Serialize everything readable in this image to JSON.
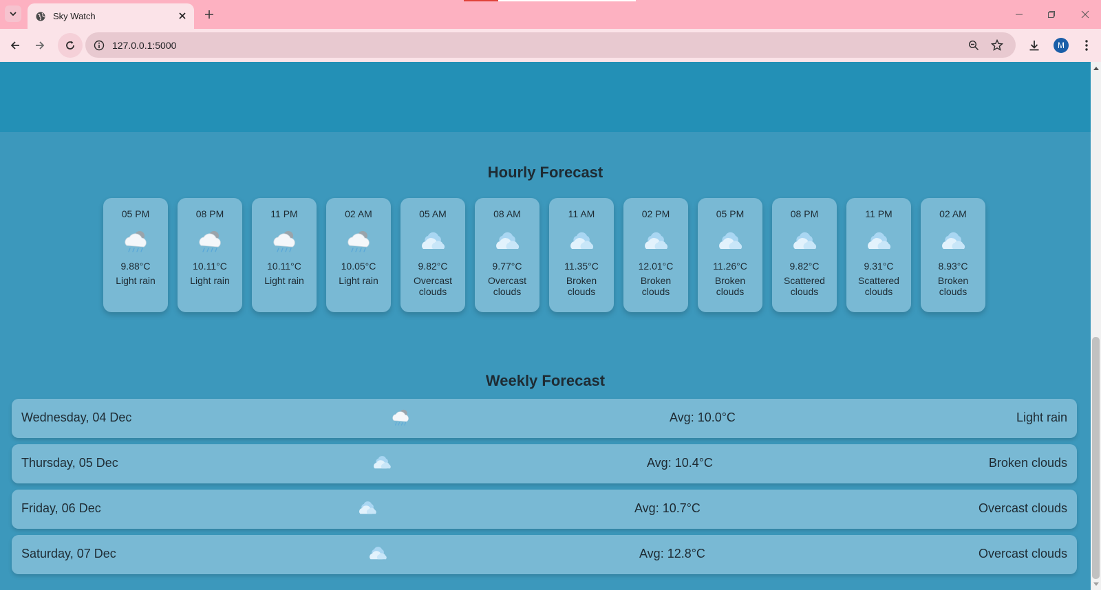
{
  "browser": {
    "tab_title": "Sky Watch",
    "url": "127.0.0.1:5000",
    "profile_initial": "M",
    "icons": {
      "tab_search": "chevron-down-icon",
      "tab_favicon": "globe-icon",
      "tab_close": "close-icon",
      "new_tab": "plus-icon",
      "minimize": "minimize-icon",
      "restore": "restore-icon",
      "window_close": "close-icon",
      "back": "arrow-left-icon",
      "forward": "arrow-right-icon",
      "reload": "reload-icon",
      "site_info": "info-icon",
      "zoom": "zoom-out-icon",
      "bookmark": "star-icon",
      "downloads": "download-icon",
      "menu": "kebab-menu-icon"
    }
  },
  "hourly": {
    "title": "Hourly Forecast",
    "items": [
      {
        "time": "05 PM",
        "temp": "9.88°C",
        "desc": "Light rain",
        "icon": "rain-cloud-icon"
      },
      {
        "time": "08 PM",
        "temp": "10.11°C",
        "desc": "Light rain",
        "icon": "rain-cloud-icon"
      },
      {
        "time": "11 PM",
        "temp": "10.11°C",
        "desc": "Light rain",
        "icon": "rain-cloud-icon"
      },
      {
        "time": "02 AM",
        "temp": "10.05°C",
        "desc": "Light rain",
        "icon": "rain-cloud-icon"
      },
      {
        "time": "05 AM",
        "temp": "9.82°C",
        "desc": "Overcast clouds",
        "icon": "clouds-icon"
      },
      {
        "time": "08 AM",
        "temp": "9.77°C",
        "desc": "Overcast clouds",
        "icon": "clouds-icon"
      },
      {
        "time": "11 AM",
        "temp": "11.35°C",
        "desc": "Broken clouds",
        "icon": "clouds-icon"
      },
      {
        "time": "02 PM",
        "temp": "12.01°C",
        "desc": "Broken clouds",
        "icon": "clouds-icon"
      },
      {
        "time": "05 PM",
        "temp": "11.26°C",
        "desc": "Broken clouds",
        "icon": "clouds-icon"
      },
      {
        "time": "08 PM",
        "temp": "9.82°C",
        "desc": "Scattered clouds",
        "icon": "clouds-icon"
      },
      {
        "time": "11 PM",
        "temp": "9.31°C",
        "desc": "Scattered clouds",
        "icon": "clouds-icon"
      },
      {
        "time": "02 AM",
        "temp": "8.93°C",
        "desc": "Broken clouds",
        "icon": "clouds-icon"
      }
    ]
  },
  "weekly": {
    "title": "Weekly Forecast",
    "items": [
      {
        "day": "Wednesday, 04 Dec",
        "avg": "Avg: 10.0°C",
        "desc": "Light rain",
        "icon": "rain-cloud-icon"
      },
      {
        "day": "Thursday, 05 Dec",
        "avg": "Avg: 10.4°C",
        "desc": "Broken clouds",
        "icon": "clouds-icon"
      },
      {
        "day": "Friday, 06 Dec",
        "avg": "Avg: 10.7°C",
        "desc": "Overcast clouds",
        "icon": "clouds-icon"
      },
      {
        "day": "Saturday, 07 Dec",
        "avg": "Avg: 12.8°C",
        "desc": "Overcast clouds",
        "icon": "clouds-icon"
      }
    ]
  },
  "colors": {
    "tabbar": "#fdb1c1",
    "toolbar": "#fbe3e8",
    "page_bg": "#3c98bc",
    "header_band": "#2390b6",
    "card": "#79b9d4"
  }
}
